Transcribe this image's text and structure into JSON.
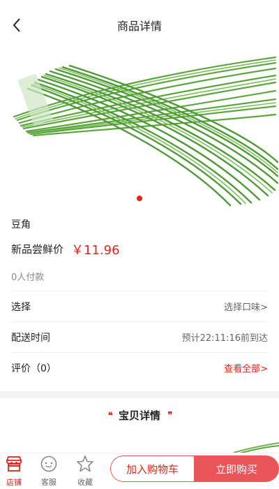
{
  "header": {
    "title": "商品详情",
    "back_icon": "chevron-left-icon"
  },
  "gallery": {
    "image_subject": "green long beans",
    "active_index": 0,
    "total": 1
  },
  "product": {
    "name": "豆角",
    "promo_label": "新品尝鲜价",
    "price": "￥11.96",
    "paid_count": "0人付款"
  },
  "rows": [
    {
      "label": "选择",
      "value": "选择口味>"
    },
    {
      "label": "配送时间",
      "value": "预计22:11:16前到达"
    },
    {
      "label": "评价（0）",
      "value": "查看全部>"
    }
  ],
  "details": {
    "title": "宝贝详情",
    "quote_left": "❛❛",
    "quote_right": "❜❜"
  },
  "tabbar": {
    "items": [
      {
        "label": "店铺",
        "icon": "store-icon"
      },
      {
        "label": "客服",
        "icon": "customer-service-icon"
      },
      {
        "label": "收藏",
        "icon": "star-icon"
      }
    ],
    "add_to_cart": "加入购物车",
    "buy_now": "立即购买"
  },
  "colors": {
    "accent": "#e1251b",
    "button": "#e8555b"
  }
}
